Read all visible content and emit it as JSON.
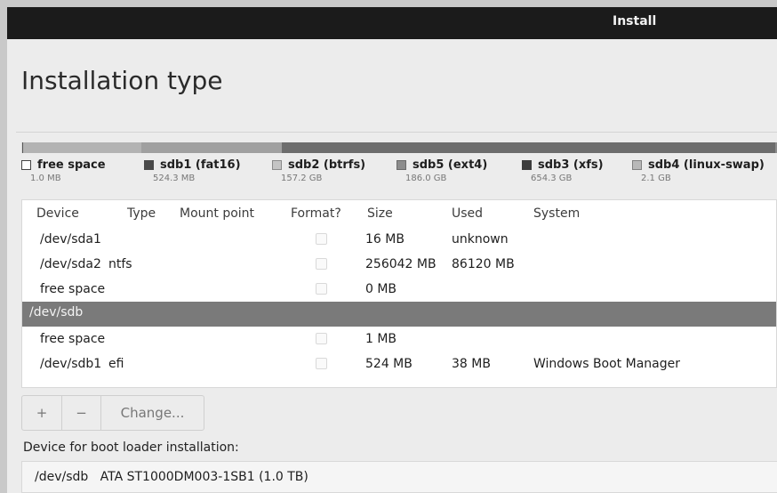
{
  "window": {
    "title": "Install"
  },
  "page": {
    "title": "Installation type"
  },
  "usage_bar": {
    "segments": [
      {
        "name": "free space",
        "fraction": 0.001,
        "color": "#d8d8d8"
      },
      {
        "name": "sdb1 (fat16)",
        "fraction": 0.001,
        "color": "#555555"
      },
      {
        "name": "sdb2 (btrfs)",
        "fraction": 0.157,
        "color": "#b3b3b3"
      },
      {
        "name": "sdb5 (ext4)",
        "fraction": 0.186,
        "color": "#a0a0a0"
      },
      {
        "name": "sdb3 (xfs)",
        "fraction": 0.653,
        "color": "#6d6d6d"
      },
      {
        "name": "sdb4 (linux-swap)",
        "fraction": 0.002,
        "color": "#8d8d8d"
      }
    ]
  },
  "legend": [
    {
      "label": "free space",
      "size": "1.0 MB",
      "color": "#ffffff",
      "border": "#444444"
    },
    {
      "label": "sdb1 (fat16)",
      "size": "524.3 MB",
      "color": "#4a4a4a",
      "border": "#4a4a4a"
    },
    {
      "label": "sdb2 (btrfs)",
      "size": "157.2 GB",
      "color": "#c4c4c4",
      "border": "#8a8a8a"
    },
    {
      "label": "sdb5 (ext4)",
      "size": "186.0 GB",
      "color": "#8c8c8c",
      "border": "#6a6a6a"
    },
    {
      "label": "sdb3 (xfs)",
      "size": "654.3 GB",
      "color": "#3d3d3d",
      "border": "#3d3d3d"
    },
    {
      "label": "sdb4 (linux-swap)",
      "size": "2.1 GB",
      "color": "#b8b8b8",
      "border": "#808080"
    }
  ],
  "table": {
    "headers": {
      "device": "Device",
      "type": "Type",
      "mount": "Mount point",
      "format": "Format?",
      "size": "Size",
      "used": "Used",
      "system": "System"
    },
    "rows": [
      {
        "device": "/dev/sda1",
        "type": "",
        "mount": "",
        "size": "16 MB",
        "used": "unknown",
        "system": "",
        "format_visible": true
      },
      {
        "device": "/dev/sda2",
        "type": "ntfs",
        "mount": "",
        "size": "256042 MB",
        "used": "86120 MB",
        "system": "",
        "format_visible": true
      },
      {
        "device": "free space",
        "type": "",
        "mount": "",
        "size": "0 MB",
        "used": "",
        "system": "",
        "format_visible": true
      },
      {
        "device": "/dev/sdb",
        "selected": true
      },
      {
        "device": "free space",
        "type": "",
        "mount": "",
        "size": "1 MB",
        "used": "",
        "system": "",
        "format_visible": true
      },
      {
        "device": "/dev/sdb1",
        "type": "efi",
        "mount": "",
        "size": "524 MB",
        "used": "38 MB",
        "system": "Windows Boot Manager",
        "format_visible": true
      }
    ]
  },
  "toolbar": {
    "add_label": "+",
    "remove_label": "−",
    "change_label": "Change..."
  },
  "boot": {
    "label": "Device for boot loader installation:",
    "selected": "/dev/sdb   ATA ST1000DM003-1SB1 (1.0 TB)"
  },
  "colors": {
    "titlebar": "#1b1b1b",
    "selected_row": "#7a7a7a"
  }
}
